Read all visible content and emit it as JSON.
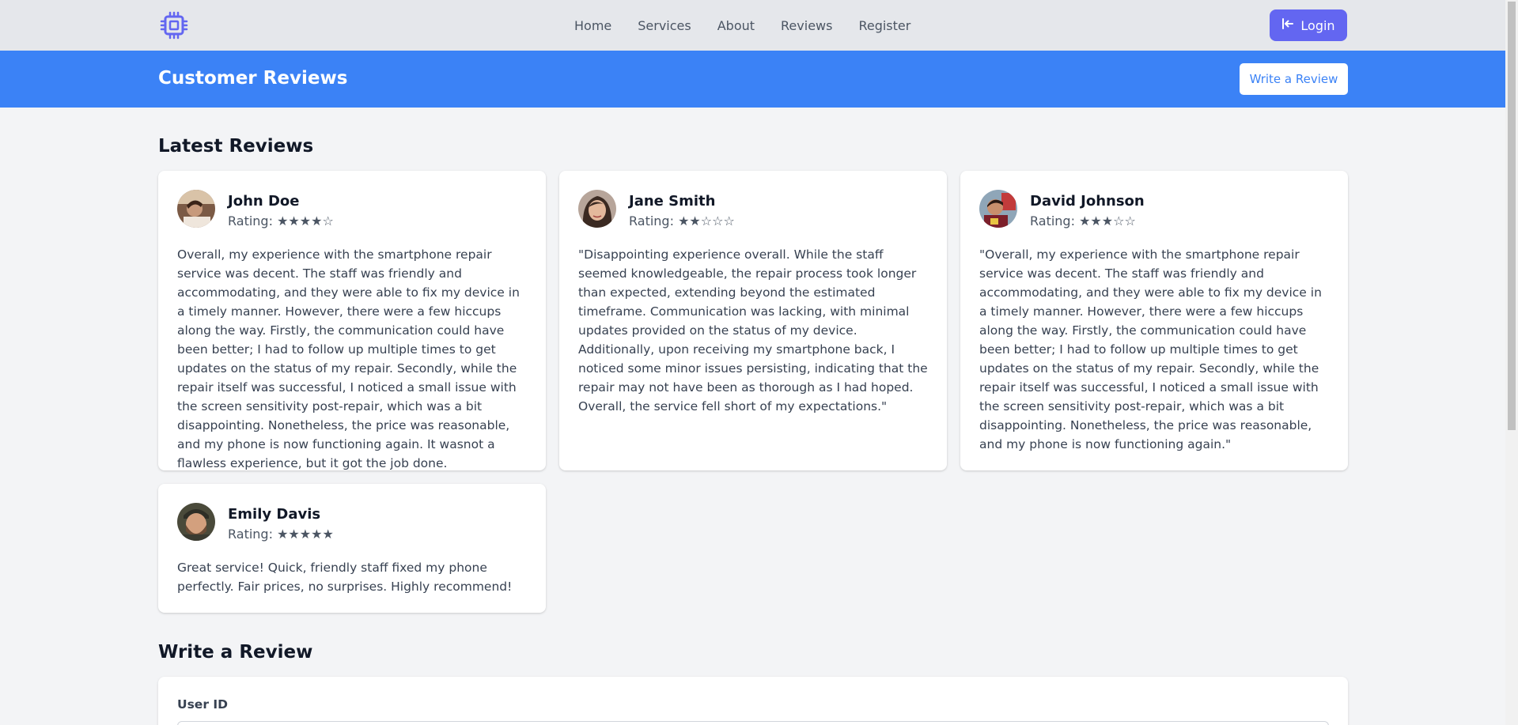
{
  "nav": {
    "logo_icon": "chip-icon",
    "links": [
      "Home",
      "Services",
      "About",
      "Reviews",
      "Register"
    ],
    "login_label": "Login",
    "login_icon": "login-arrow-icon"
  },
  "banner": {
    "title": "Customer Reviews",
    "write_button": "Write a Review"
  },
  "latest": {
    "heading": "Latest Reviews",
    "reviews": [
      {
        "name": "John Doe",
        "rating_text": "Rating: ★★★★☆",
        "rating": 4,
        "text": "Overall, my experience with the smartphone repair service was decent. The staff was friendly and accommodating, and they were able to fix my device in a timely manner. However, there were a few hiccups along the way. Firstly, the communication could have been better; I had to follow up multiple times to get updates on the status of my repair. Secondly, while the repair itself was successful, I noticed a small issue with the screen sensitivity post-repair, which was a bit disappointing. Nonetheless, the price was reasonable, and my phone is now functioning again. It wasnot a flawless experience, but it got the job done."
      },
      {
        "name": "Jane Smith",
        "rating_text": "Rating: ★★☆☆☆",
        "rating": 2,
        "text": "\"Disappointing experience overall. While the staff seemed knowledgeable, the repair process took longer than expected, extending beyond the estimated timeframe. Communication was lacking, with minimal updates provided on the status of my device. Additionally, upon receiving my smartphone back, I noticed some minor issues persisting, indicating that the repair may not have been as thorough as I had hoped. Overall, the service fell short of my expectations.\""
      },
      {
        "name": "David Johnson",
        "rating_text": "Rating: ★★★☆☆",
        "rating": 3,
        "text": "\"Overall, my experience with the smartphone repair service was decent. The staff was friendly and accommodating, and they were able to fix my device in a timely manner. However, there were a few hiccups along the way. Firstly, the communication could have been better; I had to follow up multiple times to get updates on the status of my repair. Secondly, while the repair itself was successful, I noticed a small issue with the screen sensitivity post-repair, which was a bit disappointing. Nonetheless, the price was reasonable, and my phone is now functioning again.\""
      },
      {
        "name": "Emily Davis",
        "rating_text": "Rating: ★★★★★",
        "rating": 5,
        "text": "Great service! Quick, friendly staff fixed my phone perfectly. Fair prices, no surprises. Highly recommend!"
      }
    ]
  },
  "form": {
    "heading": "Write a Review",
    "user_id_label": "User ID"
  },
  "colors": {
    "accent": "#6366f1",
    "banner": "#3b82f6",
    "nav_bg": "#e5e7eb",
    "page_bg": "#f3f4f6"
  }
}
